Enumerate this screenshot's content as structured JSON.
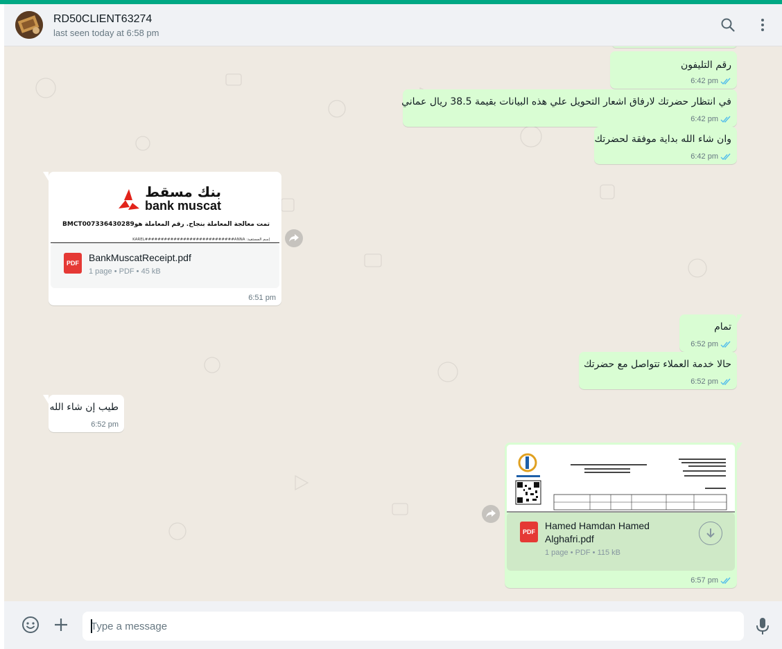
{
  "header": {
    "contact_name": "RD50CLIENT63274",
    "status": "last seen today at 6:58 pm",
    "icons": [
      "search-icon",
      "menu-dots-icon"
    ]
  },
  "messages": [
    {
      "direction": "out",
      "text": "رقم التليفون",
      "time": "6:42 pm"
    },
    {
      "direction": "out",
      "text": "في انتظار حضرتك لارفاق اشعار التحويل علي هذه البيانات بقيمة 38.5 ريال عماني",
      "time": "6:42 pm"
    },
    {
      "direction": "out",
      "text": "وان شاء الله بداية موفقة لحضرتك",
      "time": "6:42 pm"
    },
    {
      "direction": "in",
      "type": "document",
      "preview": {
        "brand_ar": "بنك مسقط",
        "brand_en": "bank muscat",
        "line1": "تمت معالجة المعاملة بنجاح. رقم المعاملة هوBMCT007336430289",
        "line2": "إسم المستفيد: KAREL############################ANNA"
      },
      "filename": "BankMuscatReceipt.pdf",
      "meta": "1 page • PDF • 45 kB",
      "time": "6:51 pm"
    },
    {
      "direction": "out",
      "text": "تمام",
      "time": "6:52 pm"
    },
    {
      "direction": "out",
      "text": "حالا خدمة العملاء تتواصل مع حضرتك",
      "time": "6:52 pm"
    },
    {
      "direction": "in",
      "text": "طيب إن شاء الله",
      "time": "6:52 pm"
    },
    {
      "direction": "out",
      "type": "document",
      "filename_line1": "Hamed Hamdan Hamed",
      "filename_line2": "Alghafri.pdf",
      "meta": "1 page • PDF • 115 kB",
      "time": "6:57 pm"
    }
  ],
  "pdf_label": "PDF",
  "composer": {
    "placeholder": "Type a message",
    "icons": [
      "emoji-icon",
      "plus-icon",
      "microphone-icon"
    ]
  },
  "colors": {
    "accent": "#00a884",
    "outgoing_bubble": "#d9fdd3",
    "incoming_bubble": "#ffffff",
    "chat_background": "#efeae2",
    "read_tick": "#53bdeb"
  }
}
